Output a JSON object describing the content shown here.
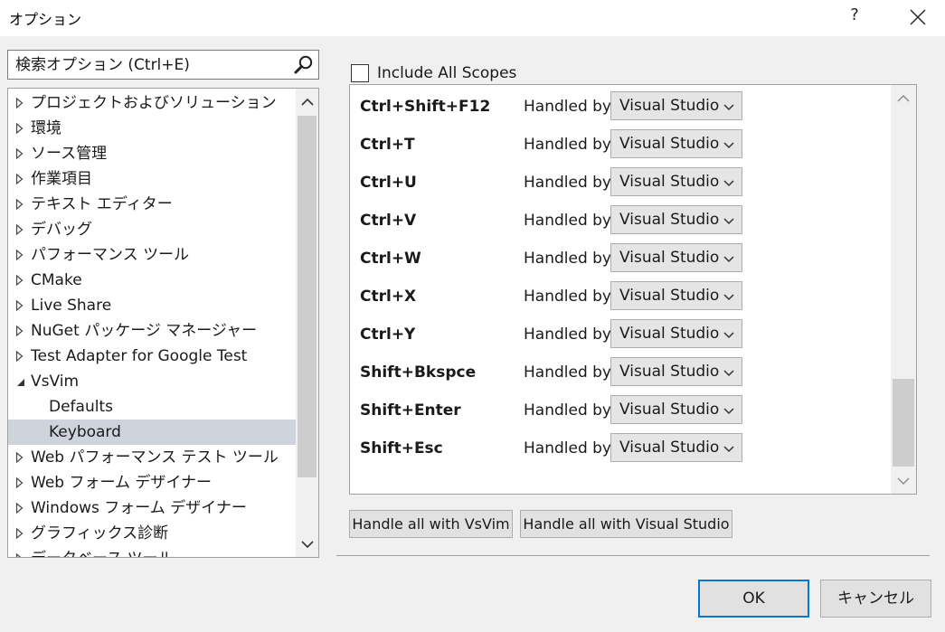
{
  "window": {
    "title": "オプション",
    "help_label": "?"
  },
  "search": {
    "placeholder": "検索オプション (Ctrl+E)"
  },
  "tree": {
    "items": [
      {
        "label": "プロジェクトおよびソリューション",
        "level": 0,
        "state": "collapsed"
      },
      {
        "label": "環境",
        "level": 0,
        "state": "collapsed"
      },
      {
        "label": "ソース管理",
        "level": 0,
        "state": "collapsed"
      },
      {
        "label": "作業項目",
        "level": 0,
        "state": "collapsed"
      },
      {
        "label": "テキスト エディター",
        "level": 0,
        "state": "collapsed"
      },
      {
        "label": "デバッグ",
        "level": 0,
        "state": "collapsed"
      },
      {
        "label": "パフォーマンス ツール",
        "level": 0,
        "state": "collapsed"
      },
      {
        "label": "CMake",
        "level": 0,
        "state": "collapsed"
      },
      {
        "label": "Live Share",
        "level": 0,
        "state": "collapsed"
      },
      {
        "label": "NuGet パッケージ マネージャー",
        "level": 0,
        "state": "collapsed"
      },
      {
        "label": "Test Adapter for Google Test",
        "level": 0,
        "state": "collapsed"
      },
      {
        "label": "VsVim",
        "level": 0,
        "state": "expanded"
      },
      {
        "label": "Defaults",
        "level": 1,
        "state": "leaf"
      },
      {
        "label": "Keyboard",
        "level": 1,
        "state": "leaf",
        "selected": true
      },
      {
        "label": "Web パフォーマンス テスト ツール",
        "level": 0,
        "state": "collapsed"
      },
      {
        "label": "Web フォーム デザイナー",
        "level": 0,
        "state": "collapsed"
      },
      {
        "label": "Windows フォーム デザイナー",
        "level": 0,
        "state": "collapsed"
      },
      {
        "label": "グラフィックス診断",
        "level": 0,
        "state": "collapsed"
      },
      {
        "label": "データベース ツール",
        "level": 0,
        "state": "collapsed"
      }
    ]
  },
  "scopes": {
    "checkbox_label": "Include All Scopes",
    "checked": false
  },
  "keys": [
    {
      "key": "Ctrl+Shift+F12",
      "handled_label": "Handled by",
      "handler": "Visual Studio"
    },
    {
      "key": "Ctrl+T",
      "handled_label": "Handled by",
      "handler": "Visual Studio"
    },
    {
      "key": "Ctrl+U",
      "handled_label": "Handled by",
      "handler": "Visual Studio"
    },
    {
      "key": "Ctrl+V",
      "handled_label": "Handled by",
      "handler": "Visual Studio"
    },
    {
      "key": "Ctrl+W",
      "handled_label": "Handled by",
      "handler": "Visual Studio"
    },
    {
      "key": "Ctrl+X",
      "handled_label": "Handled by",
      "handler": "Visual Studio"
    },
    {
      "key": "Ctrl+Y",
      "handled_label": "Handled by",
      "handler": "Visual Studio"
    },
    {
      "key": "Shift+Bkspce",
      "handled_label": "Handled by",
      "handler": "Visual Studio"
    },
    {
      "key": "Shift+Enter",
      "handled_label": "Handled by",
      "handler": "Visual Studio"
    },
    {
      "key": "Shift+Esc",
      "handled_label": "Handled by",
      "handler": "Visual Studio"
    }
  ],
  "actions": {
    "handle_vsvim": "Handle all with VsVim",
    "handle_vs": "Handle all with Visual Studio"
  },
  "footer": {
    "ok": "OK",
    "cancel": "キャンセル"
  },
  "colors": {
    "selection": "#cfd3dc",
    "ok_border": "#0078d7",
    "window_bg": "#f0f0f0"
  }
}
